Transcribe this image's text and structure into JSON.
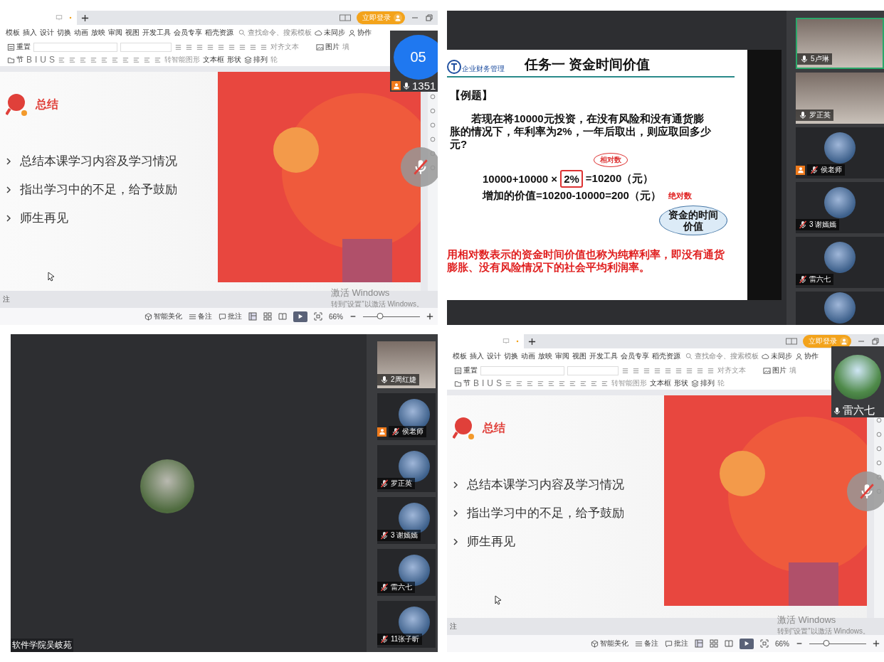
{
  "top_left_window": {
    "login": "立即登录",
    "menu": [
      "模板",
      "插入",
      "设计",
      "切换",
      "动画",
      "放映",
      "审阅",
      "视图",
      "开发工具",
      "会员专享",
      "稻壳资源"
    ],
    "search_placeholder": "查找命令、搜索模板",
    "sync": "未同步",
    "collab": "协作",
    "toolbar_row_1": [
      "重置",
      "对齐文本",
      "图片",
      "填"
    ],
    "format_buttons": [
      "B",
      "I",
      "U",
      "S"
    ],
    "toolbar_row_2": [
      "节",
      "转智能图形",
      "文本框",
      "形状",
      "排列",
      "轮"
    ],
    "slide": {
      "heading": "总结",
      "bullets": [
        "总结本课学习内容及学习情况",
        "指出学习中的不足，给予鼓励",
        "师生再见"
      ]
    },
    "notes_label": "注",
    "activation": {
      "title": "激活 Windows",
      "hint": "转到“设置”以激活 Windows。"
    },
    "status_buttons": [
      "智能美化",
      "备注",
      "批注"
    ],
    "zoom": "66%",
    "zoom_slider": {
      "level": 0.3
    },
    "overlay": {
      "kind": "number",
      "number": "05",
      "name": "1351",
      "host": true,
      "muted": false
    }
  },
  "top_right_meeting": {
    "slide": {
      "logo_text": "企业财务管理",
      "title": "任务一 资金时间价值",
      "example": "【例题】",
      "question": "若现在将10000元投资，在没有风险和没有通货膨胀的情况下，年利率为2%，一年后取出，则应取回多少元?",
      "callout": "相对数",
      "formula_start": "10000+10000 ×",
      "formula_box": "2%",
      "formula_end": "=10200（元）",
      "increase": "增加的价值=10200-10000=200（元）",
      "absolute_note": "绝对数",
      "bubble": "资金的时间价值",
      "conclusion": "用相对数表示的资金时间价值也称为纯粹利率，即没有通货膨胀、没有风险情况下的社会平均利润率。"
    },
    "participants": [
      {
        "kind": "camera",
        "name": "5卢琳",
        "muted": false,
        "host": false,
        "speaking": true
      },
      {
        "kind": "camera",
        "name": "罗正英",
        "muted": false,
        "host": false,
        "speaking": false
      },
      {
        "kind": "avatar",
        "name": "侯老师",
        "muted": true,
        "host": true,
        "speaking": false
      },
      {
        "kind": "avatar",
        "name": "3 谢嫣嫣",
        "muted": true,
        "host": false,
        "speaking": false
      },
      {
        "kind": "avatar",
        "name": "雷六七",
        "muted": true,
        "host": false,
        "speaking": false
      },
      {
        "kind": "avatar",
        "speaking": false
      }
    ]
  },
  "bottom_left_meeting": {
    "presenter": "软件学院吴岐苑",
    "participants": [
      {
        "kind": "camera",
        "name": "2周红婕",
        "muted": false,
        "host": false,
        "speaking": false
      },
      {
        "kind": "avatar",
        "name": "侯老师",
        "muted": true,
        "host": true,
        "speaking": false
      },
      {
        "kind": "avatar",
        "name": "罗正英",
        "muted": true,
        "host": false,
        "speaking": false
      },
      {
        "kind": "avatar",
        "name": "3 谢嫣嫣",
        "muted": true,
        "host": false,
        "speaking": false
      },
      {
        "kind": "avatar",
        "name": "雷六七",
        "muted": true,
        "host": false,
        "speaking": false
      },
      {
        "kind": "avatar",
        "name": "11张子昕",
        "muted": true,
        "host": false,
        "speaking": false
      }
    ]
  },
  "bottom_right_window": {
    "login": "立即登录",
    "menu": [
      "模板",
      "插入",
      "设计",
      "切换",
      "动画",
      "放映",
      "审阅",
      "视图",
      "开发工具",
      "会员专享",
      "稻壳资源"
    ],
    "search_placeholder": "查找命令、搜索模板",
    "sync": "未同步",
    "collab": "协作",
    "toolbar_row_1": [
      "重置",
      "对齐文本",
      "图片",
      "填"
    ],
    "format_buttons": [
      "B",
      "I",
      "U",
      "S"
    ],
    "toolbar_row_2": [
      "节",
      "转智能图形",
      "文本框",
      "形状",
      "排列",
      "轮"
    ],
    "slide": {
      "heading": "总结",
      "bullets": [
        "总结本课学习内容及学习情况",
        "指出学习中的不足，给予鼓励",
        "师生再见"
      ]
    },
    "notes_label": "注",
    "activation": {
      "title": "激活 Windows",
      "hint": "转到“设置”以激活 Windows。"
    },
    "status_buttons": [
      "智能美化",
      "备注",
      "批注"
    ],
    "zoom": "66%",
    "zoom_slider": {
      "level": 0.3
    },
    "overlay": {
      "kind": "avatar",
      "name": "雷六七",
      "host": false,
      "muted": false
    }
  }
}
